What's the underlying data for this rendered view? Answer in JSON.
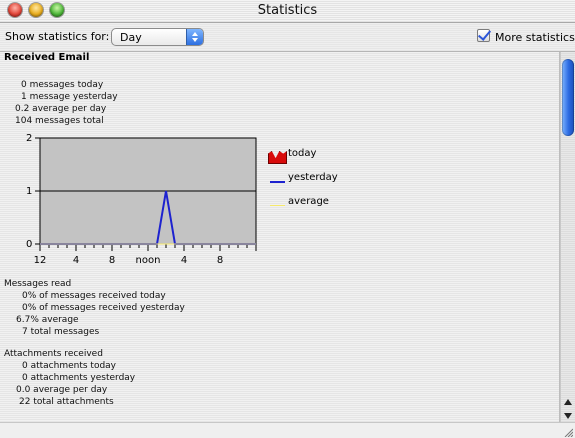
{
  "window": {
    "title": "Statistics"
  },
  "toolbar": {
    "show_label": "Show statistics for:",
    "period_selected": "Day",
    "more_statistics_label": "More statistics"
  },
  "received_email": {
    "title": "Received Email",
    "stats": [
      "0 messages today",
      "1 message yesterday",
      "0.2 average per day",
      "104 messages total"
    ]
  },
  "messages_read": {
    "title": "Messages read",
    "stats": [
      "0% of messages received today",
      "0% of messages received yesterday",
      "6.7% average",
      "7 total messages"
    ]
  },
  "attachments_received": {
    "title": "Attachments received",
    "stats": [
      "0 attachments today",
      "0 attachments yesterday",
      "0.0 average per day",
      "22 total attachments"
    ]
  },
  "chart_data": {
    "type": "line",
    "y_ticks": [
      "0",
      "1",
      "2"
    ],
    "x_tick_labels": [
      "12",
      "4",
      "8",
      "noon",
      "4",
      "8"
    ],
    "ylim": [
      0,
      2
    ],
    "xlim": [
      0,
      24
    ],
    "series": [
      {
        "name": "today",
        "color": "#d80b0b",
        "values": [
          0,
          0,
          0,
          0,
          0,
          0,
          0,
          0,
          0,
          0,
          0,
          0,
          0,
          0,
          0,
          0,
          0,
          0,
          0,
          0,
          0,
          0,
          0,
          0,
          0
        ]
      },
      {
        "name": "yesterday",
        "color": "#1d22cf",
        "values": [
          0,
          0,
          0,
          0,
          0,
          0,
          0,
          0,
          0,
          0,
          0,
          0,
          0,
          0,
          1,
          0,
          0,
          0,
          0,
          0,
          0,
          0,
          0,
          0,
          0
        ]
      },
      {
        "name": "average",
        "color": "#f5e86b",
        "values": [
          0,
          0,
          0,
          0,
          0,
          0,
          0,
          0,
          0,
          0,
          0,
          0,
          0,
          0,
          0,
          0,
          0,
          0,
          0,
          0,
          0,
          0,
          0,
          0,
          0
        ]
      }
    ]
  }
}
